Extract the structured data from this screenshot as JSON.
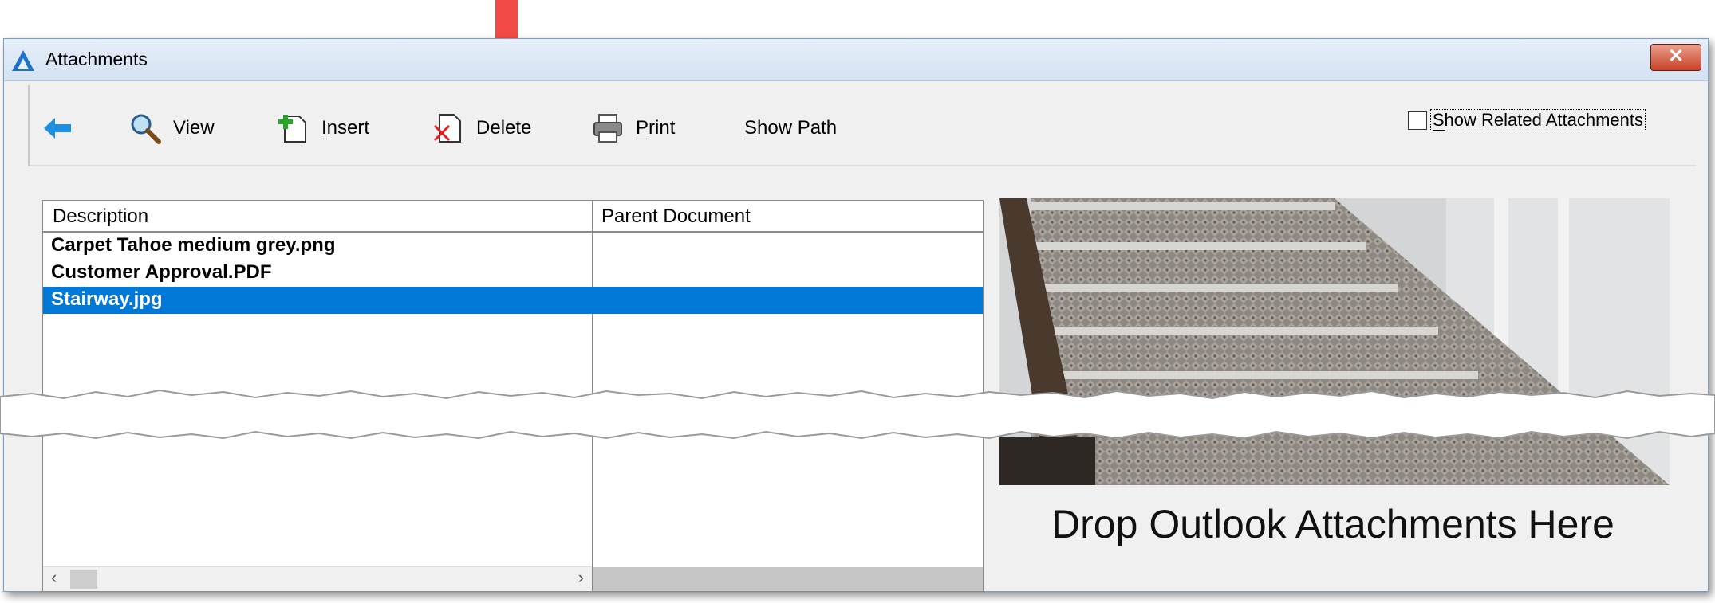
{
  "window": {
    "title": "Attachments",
    "close_symbol": "✕"
  },
  "toolbar": {
    "back_icon": "back-arrow-icon",
    "buttons": [
      {
        "label": "View",
        "underline": "V",
        "rest": "iew",
        "icon": "magnifier-icon"
      },
      {
        "label": "Insert",
        "underline": "I",
        "rest": "nsert",
        "icon": "insert-document-icon"
      },
      {
        "label": "Delete",
        "underline": "D",
        "rest": "elete",
        "icon": "delete-document-icon"
      },
      {
        "label": "Print",
        "underline": "P",
        "rest": "rint",
        "icon": "printer-icon"
      },
      {
        "label": "Show Path",
        "underline": "S",
        "rest": "how Path"
      }
    ],
    "related_checkbox_label_u": "S",
    "related_checkbox_label_rest": "how Related Attachments"
  },
  "grid": {
    "columns": [
      "Description",
      "Parent Document"
    ],
    "rows": [
      {
        "description": "Carpet Tahoe medium grey.png",
        "parent": ""
      },
      {
        "description": "Customer Approval.PDF",
        "parent": ""
      },
      {
        "description": "Stairway.jpg",
        "parent": "",
        "selected": true
      }
    ],
    "scroll_left": "‹",
    "scroll_right": "›"
  },
  "drop_zone": {
    "text": "Drop Outlook Attachments Here"
  },
  "colors": {
    "selection": "#0078d7",
    "accent_arrow": "#f24a46"
  }
}
